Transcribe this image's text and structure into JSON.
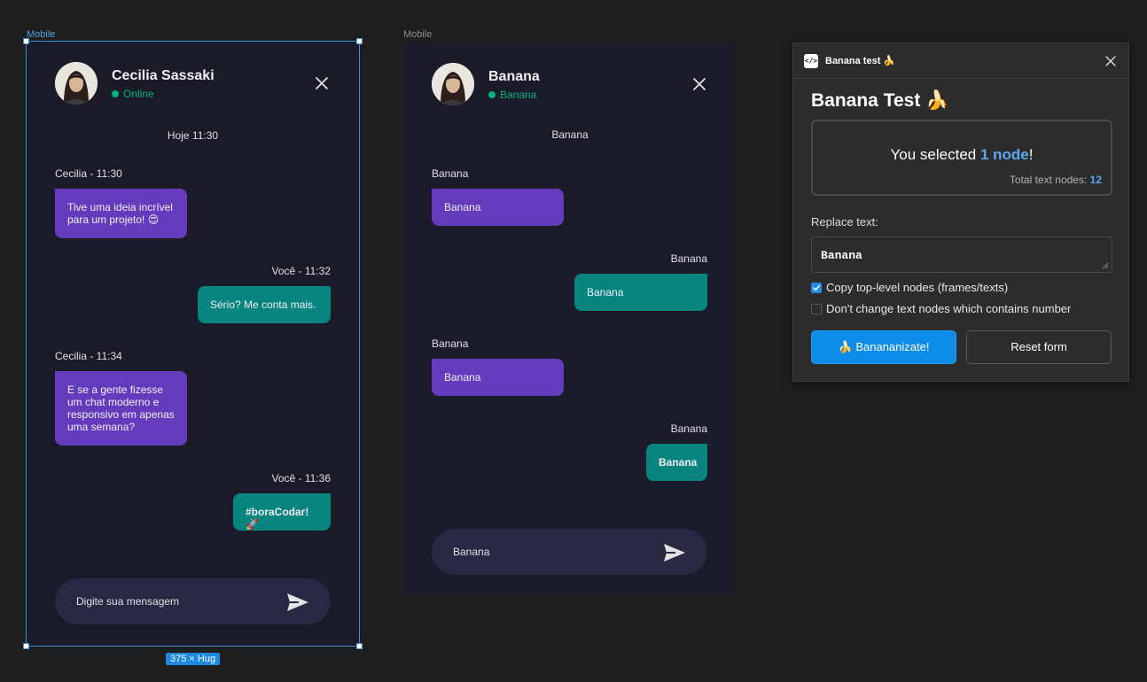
{
  "canvas": {
    "frame1_label": "Mobile",
    "frame2_label": "Mobile",
    "size_badge": "375 × Hug"
  },
  "chat1": {
    "contact_name": "Cecilia Sassaki",
    "status": "Online",
    "day_label": "Hoje 11:30",
    "messages": [
      {
        "meta": "Cecilia - 11:30",
        "text": "Tive uma ideia incrível para um projeto! 😍",
        "direction": "in"
      },
      {
        "meta": "Você - 11:32",
        "text": "Sério? Me conta mais.",
        "direction": "out"
      },
      {
        "meta": "Cecilia - 11:34",
        "text": "E se a gente fizesse um chat moderno e responsivo em apenas uma semana?",
        "direction": "in"
      },
      {
        "meta": "Você - 11:36",
        "text": "#boraCodar! 🚀",
        "direction": "out"
      }
    ],
    "composer_placeholder": "Digite sua mensagem"
  },
  "chat2": {
    "contact_name": "Banana",
    "status": "Banana",
    "day_label": "Banana",
    "messages": [
      {
        "meta": "Banana",
        "text": "Banana",
        "direction": "in"
      },
      {
        "meta": "Banana",
        "text": "Banana",
        "direction": "out"
      },
      {
        "meta": "Banana",
        "text": "Banana",
        "direction": "in"
      },
      {
        "meta": "Banana",
        "text": "Banana",
        "direction": "out"
      }
    ],
    "composer_placeholder": "Banana"
  },
  "plugin": {
    "window_title": "Banana test 🍌",
    "heading": "Banana Test 🍌",
    "selected_prefix": "You selected ",
    "selected_count": "1 node",
    "selected_suffix": "!",
    "total_label": "Total text nodes: ",
    "total_count": "12",
    "replace_label": "Replace text:",
    "replace_value": "Banana",
    "option_copy": {
      "label": "Copy top-level nodes (frames/texts)",
      "checked": true
    },
    "option_numbers": {
      "label": "Don't change text nodes which contains number",
      "checked": false
    },
    "primary_button": "🍌 Banananizate!",
    "secondary_button": "Reset form"
  },
  "colors": {
    "incoming_bubble": "#633bbc",
    "outgoing_bubble": "#07847e",
    "online": "#00b37e",
    "accent": "#0d8ce9"
  }
}
